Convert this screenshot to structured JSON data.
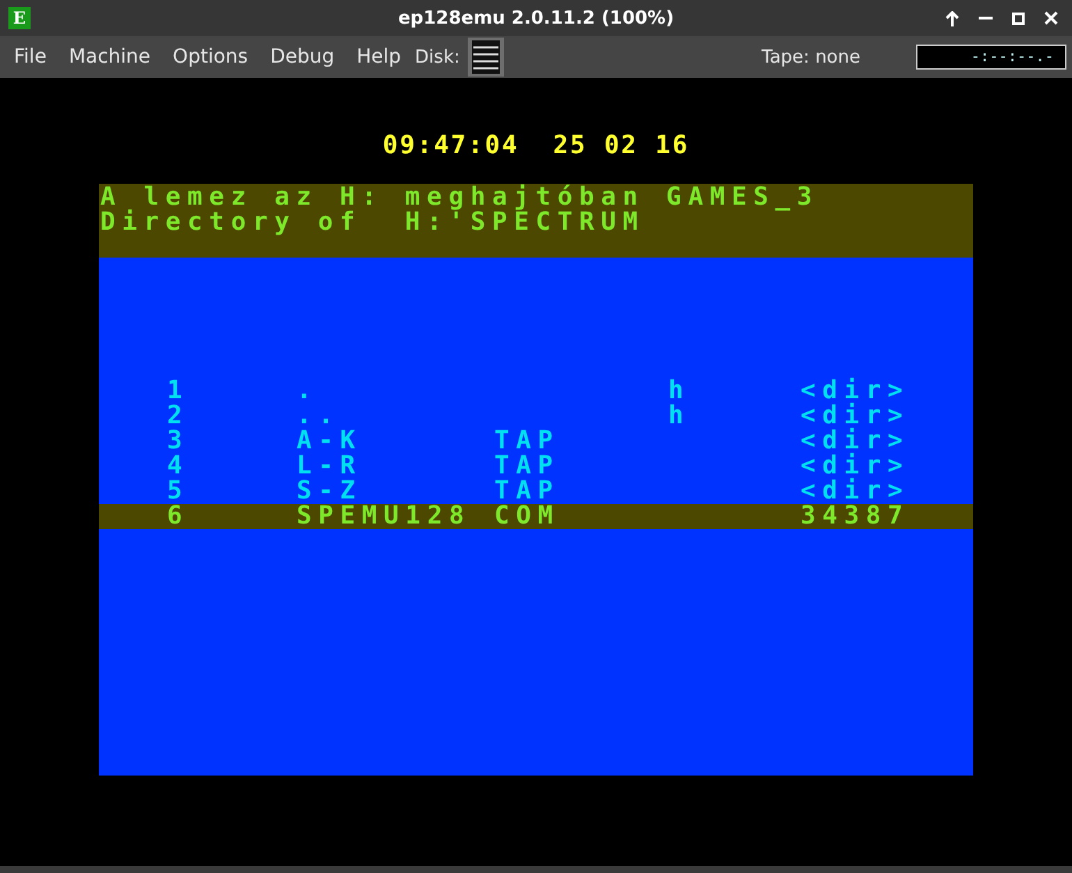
{
  "window": {
    "icon_letter": "E",
    "title": "ep128emu 2.0.11.2 (100%)"
  },
  "menu": [
    "File",
    "Machine",
    "Options",
    "Debug",
    "Help"
  ],
  "disk": {
    "label": "Disk:"
  },
  "tape": {
    "label": "Tape: none",
    "position": "-:--:--.-"
  },
  "screen": {
    "clock": "09:47:04  25 02 16",
    "header": [
      "A lemez az H: meghajtóban GAMES_3",
      "Directory of  H:'SPECTRUM"
    ],
    "rows": [
      {
        "number": "1",
        "name": ".",
        "ext": "",
        "attr": "h",
        "size": "<dir>",
        "selected": false
      },
      {
        "number": "2",
        "name": "..",
        "ext": "",
        "attr": "h",
        "size": "<dir>",
        "selected": false
      },
      {
        "number": "3",
        "name": "A-K",
        "ext": "TAP",
        "attr": "",
        "size": "<dir>",
        "selected": false
      },
      {
        "number": "4",
        "name": "L-R",
        "ext": "TAP",
        "attr": "",
        "size": "<dir>",
        "selected": false
      },
      {
        "number": "5",
        "name": "S-Z",
        "ext": "TAP",
        "attr": "",
        "size": "<dir>",
        "selected": false
      },
      {
        "number": "6",
        "name": "SPEMU128",
        "ext": "COM",
        "attr": "",
        "size": "34387",
        "selected": true
      }
    ]
  }
}
